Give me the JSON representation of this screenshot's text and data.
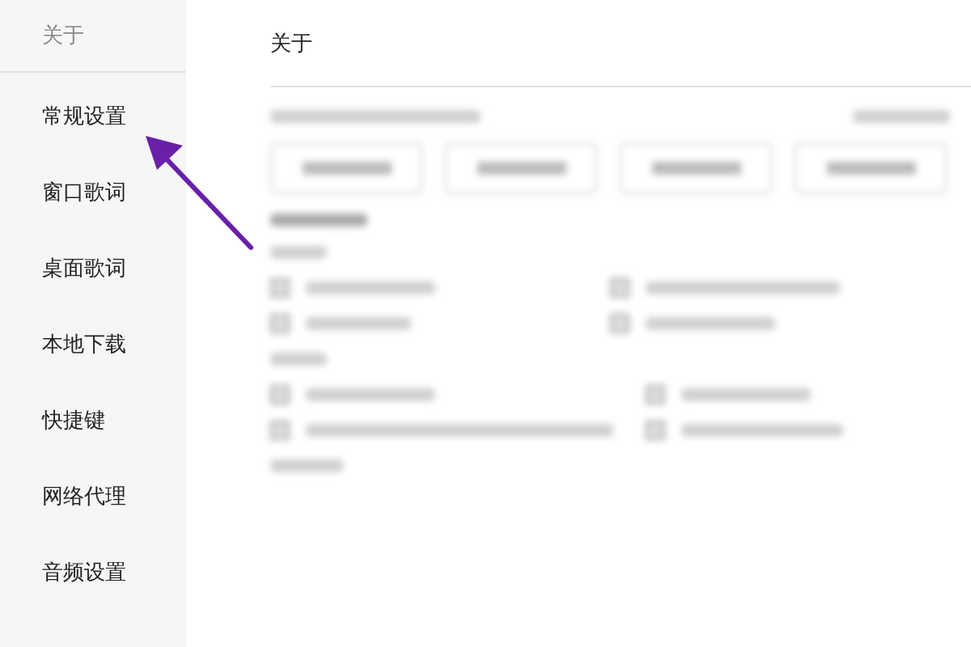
{
  "sidebar": {
    "items": [
      {
        "label": "关于",
        "selected": true
      },
      {
        "label": "常规设置",
        "selected": false
      },
      {
        "label": "窗口歌词",
        "selected": false
      },
      {
        "label": "桌面歌词",
        "selected": false
      },
      {
        "label": "本地下载",
        "selected": false
      },
      {
        "label": "快捷键",
        "selected": false
      },
      {
        "label": "网络代理",
        "selected": false
      },
      {
        "label": "音频设置",
        "selected": false
      }
    ]
  },
  "main": {
    "title": "关于"
  }
}
